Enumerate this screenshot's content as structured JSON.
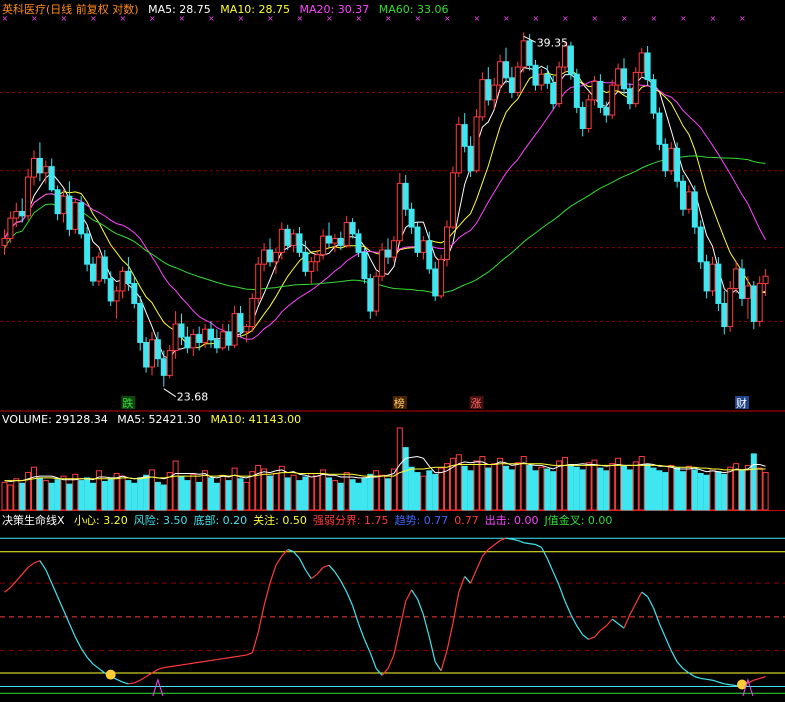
{
  "colors": {
    "background": "#000000",
    "up": "#ff3b3b",
    "down": "#3fe6f0",
    "ma5": "#ffffff",
    "ma10": "#ffff33",
    "ma20": "#ff44ff",
    "ma60": "#33dd33",
    "grid": "#8b0000",
    "separator": "#c00000",
    "marker": "#ff44ff"
  },
  "price_panel": {
    "title": "英科医疗(日线 前复权 对数)",
    "ma5": "MA5: 28.75",
    "ma10": "MA10: 28.75",
    "ma20": "MA20: 30.37",
    "ma60": "MA60: 33.06",
    "high_label": "39.35",
    "low_label": "23.68",
    "events": [
      {
        "text": "跌",
        "color": "#33dd33",
        "bg": "#114411",
        "index": 21
      },
      {
        "text": "榜",
        "color": "#ffcc66",
        "bg": "#442200",
        "index": 67
      },
      {
        "text": "涨",
        "color": "#ff6666",
        "bg": "#441111",
        "index": 80
      },
      {
        "text": "财",
        "color": "#ffffff",
        "bg": "#224488",
        "index": 125
      }
    ]
  },
  "volume_panel": {
    "volume": "VOLUME: 29128.34",
    "ma5": "MA5: 52421.30",
    "ma10": "MA10: 41143.00"
  },
  "indicator_panel": {
    "name": "决策生命线X",
    "items": [
      {
        "text": "小心: 3.20",
        "color": "#ffff33"
      },
      {
        "text": "风险: 3.50",
        "color": "#3fe6f0"
      },
      {
        "text": "底部: 0.20",
        "color": "#3fe6f0"
      },
      {
        "text": "关注: 0.50",
        "color": "#ffff33"
      },
      {
        "text": "强弱分界: 1.75",
        "color": "#ff3b3b"
      },
      {
        "text": "趋势: 0.77",
        "color": "#4466ff"
      },
      {
        "text": "0.77",
        "color": "#ff3b3b"
      },
      {
        "text": "出击: 0.00",
        "color": "#ff44ff"
      },
      {
        "text": "J值金叉: 0.00",
        "color": "#33dd33"
      }
    ],
    "levels": [
      3.5,
      3.2,
      1.75,
      0.5,
      0.2
    ]
  },
  "chart_data": {
    "type": "candlestick",
    "yscale": "log",
    "ylim": [
      22.8,
      41.0
    ],
    "ohlc": [
      [
        29.1,
        29.8,
        28.7,
        29.4
      ],
      [
        29.4,
        30.6,
        29.2,
        30.3
      ],
      [
        30.3,
        31.0,
        29.9,
        30.6
      ],
      [
        30.6,
        31.2,
        30.1,
        30.4
      ],
      [
        30.4,
        32.6,
        30.2,
        32.2
      ],
      [
        32.2,
        33.5,
        31.8,
        33.1
      ],
      [
        33.1,
        33.9,
        32.0,
        32.4
      ],
      [
        32.4,
        33.0,
        31.9,
        32.7
      ],
      [
        32.7,
        33.1,
        31.5,
        31.6
      ],
      [
        31.6,
        31.8,
        30.2,
        30.5
      ],
      [
        30.5,
        31.6,
        30.1,
        31.3
      ],
      [
        31.3,
        32.0,
        29.5,
        29.8
      ],
      [
        29.8,
        31.2,
        29.6,
        31.0
      ],
      [
        31.0,
        31.3,
        29.4,
        29.6
      ],
      [
        29.6,
        29.9,
        28.0,
        28.3
      ],
      [
        28.3,
        28.6,
        27.4,
        27.6
      ],
      [
        27.6,
        28.8,
        27.4,
        28.6
      ],
      [
        28.6,
        28.9,
        27.5,
        27.7
      ],
      [
        27.7,
        28.0,
        26.6,
        26.8
      ],
      [
        26.8,
        27.4,
        26.1,
        27.2
      ],
      [
        27.2,
        28.2,
        26.9,
        28.0
      ],
      [
        28.0,
        28.6,
        27.2,
        27.5
      ],
      [
        27.5,
        27.8,
        26.5,
        26.7
      ],
      [
        26.7,
        27.0,
        24.9,
        25.2
      ],
      [
        25.2,
        25.4,
        24.1,
        24.3
      ],
      [
        24.3,
        25.6,
        24.0,
        25.3
      ],
      [
        25.3,
        25.6,
        24.3,
        24.6
      ],
      [
        24.6,
        24.9,
        23.6,
        24.0
      ],
      [
        24.0,
        25.1,
        23.9,
        24.9
      ],
      [
        24.9,
        26.4,
        24.6,
        25.9
      ],
      [
        25.9,
        26.3,
        25.1,
        25.4
      ],
      [
        25.4,
        25.8,
        24.8,
        25.0
      ],
      [
        25.0,
        25.7,
        24.7,
        25.5
      ],
      [
        25.5,
        25.8,
        24.9,
        25.2
      ],
      [
        25.2,
        25.9,
        25.0,
        25.7
      ],
      [
        25.7,
        26.0,
        25.0,
        25.3
      ],
      [
        25.3,
        25.7,
        24.8,
        25.0
      ],
      [
        25.0,
        25.9,
        24.9,
        25.6
      ],
      [
        25.6,
        25.9,
        24.9,
        25.1
      ],
      [
        25.1,
        26.6,
        25.0,
        26.3
      ],
      [
        26.3,
        26.6,
        25.4,
        25.6
      ],
      [
        25.6,
        25.9,
        25.2,
        25.8
      ],
      [
        25.8,
        27.1,
        25.6,
        26.9
      ],
      [
        26.9,
        28.6,
        26.7,
        28.3
      ],
      [
        28.3,
        29.2,
        28.0,
        28.9
      ],
      [
        28.9,
        29.4,
        28.2,
        28.4
      ],
      [
        28.4,
        29.0,
        27.9,
        28.8
      ],
      [
        28.8,
        30.1,
        28.5,
        29.8
      ],
      [
        29.8,
        30.0,
        28.9,
        29.1
      ],
      [
        29.1,
        29.8,
        28.8,
        29.6
      ],
      [
        29.6,
        29.9,
        28.6,
        28.8
      ],
      [
        28.8,
        29.3,
        27.8,
        28.0
      ],
      [
        28.0,
        28.6,
        27.5,
        28.4
      ],
      [
        28.4,
        28.9,
        28.0,
        28.7
      ],
      [
        28.7,
        29.8,
        28.5,
        29.5
      ],
      [
        29.5,
        30.1,
        29.0,
        29.2
      ],
      [
        29.2,
        29.6,
        28.8,
        29.4
      ],
      [
        29.4,
        29.7,
        28.9,
        29.1
      ],
      [
        29.1,
        30.4,
        29.0,
        30.1
      ],
      [
        30.1,
        30.3,
        29.4,
        29.6
      ],
      [
        29.6,
        29.8,
        28.6,
        28.8
      ],
      [
        28.8,
        29.0,
        27.5,
        27.7
      ],
      [
        27.7,
        27.9,
        26.1,
        26.4
      ],
      [
        26.4,
        28.0,
        26.2,
        27.8
      ],
      [
        27.8,
        29.2,
        27.6,
        28.9
      ],
      [
        28.9,
        29.4,
        28.3,
        28.6
      ],
      [
        28.6,
        29.5,
        28.4,
        29.3
      ],
      [
        29.3,
        32.4,
        29.2,
        31.9
      ],
      [
        31.9,
        32.3,
        30.4,
        30.7
      ],
      [
        30.7,
        31.0,
        29.6,
        29.9
      ],
      [
        29.9,
        30.1,
        28.6,
        28.8
      ],
      [
        28.8,
        29.5,
        28.5,
        29.3
      ],
      [
        29.3,
        29.7,
        27.9,
        28.1
      ],
      [
        28.1,
        28.4,
        26.8,
        27.0
      ],
      [
        27.0,
        28.7,
        26.9,
        28.5
      ],
      [
        28.5,
        30.2,
        28.2,
        29.9
      ],
      [
        29.9,
        32.7,
        29.8,
        32.4
      ],
      [
        32.4,
        35.2,
        32.2,
        34.8
      ],
      [
        34.8,
        35.4,
        33.4,
        33.7
      ],
      [
        33.7,
        34.2,
        32.2,
        32.5
      ],
      [
        32.5,
        35.6,
        32.4,
        35.2
      ],
      [
        35.2,
        37.6,
        35.0,
        37.2
      ],
      [
        37.2,
        37.9,
        35.8,
        36.1
      ],
      [
        36.1,
        37.3,
        35.6,
        36.9
      ],
      [
        36.9,
        38.6,
        36.6,
        38.2
      ],
      [
        38.2,
        39.0,
        37.0,
        37.3
      ],
      [
        37.3,
        37.9,
        36.2,
        36.5
      ],
      [
        36.5,
        38.2,
        36.3,
        37.9
      ],
      [
        37.9,
        39.9,
        37.6,
        39.4
      ],
      [
        39.4,
        39.8,
        37.7,
        38.0
      ],
      [
        38.0,
        38.3,
        36.6,
        36.9
      ],
      [
        36.9,
        37.8,
        36.6,
        37.5
      ],
      [
        37.5,
        38.0,
        36.7,
        37.0
      ],
      [
        37.0,
        37.4,
        35.6,
        35.9
      ],
      [
        35.9,
        38.2,
        35.7,
        37.9
      ],
      [
        37.9,
        39.4,
        37.6,
        39.1
      ],
      [
        39.1,
        39.35,
        37.2,
        37.5
      ],
      [
        37.5,
        37.8,
        35.4,
        35.7
      ],
      [
        35.7,
        36.0,
        34.2,
        34.6
      ],
      [
        34.6,
        36.4,
        34.4,
        36.1
      ],
      [
        36.1,
        37.4,
        35.8,
        37.1
      ],
      [
        37.1,
        37.5,
        35.4,
        35.7
      ],
      [
        35.7,
        36.0,
        34.9,
        35.3
      ],
      [
        35.3,
        37.2,
        35.1,
        36.9
      ],
      [
        36.9,
        38.1,
        36.6,
        37.8
      ],
      [
        37.8,
        38.4,
        36.4,
        36.7
      ],
      [
        36.7,
        37.0,
        35.6,
        35.9
      ],
      [
        35.9,
        37.9,
        35.7,
        37.6
      ],
      [
        37.6,
        39.0,
        37.3,
        38.7
      ],
      [
        38.7,
        39.1,
        36.9,
        37.2
      ],
      [
        37.2,
        37.5,
        35.1,
        35.4
      ],
      [
        35.4,
        35.7,
        33.5,
        33.8
      ],
      [
        33.8,
        34.1,
        32.2,
        32.5
      ],
      [
        32.5,
        33.9,
        32.3,
        33.6
      ],
      [
        33.6,
        33.9,
        31.7,
        32.0
      ],
      [
        32.0,
        32.3,
        30.4,
        30.7
      ],
      [
        30.7,
        31.8,
        30.5,
        31.5
      ],
      [
        31.5,
        31.8,
        29.6,
        29.9
      ],
      [
        29.9,
        30.2,
        28.1,
        28.4
      ],
      [
        28.4,
        28.7,
        26.9,
        27.2
      ],
      [
        27.2,
        28.6,
        27.0,
        28.3
      ],
      [
        28.3,
        28.6,
        26.4,
        26.7
      ],
      [
        26.7,
        27.2,
        25.5,
        25.8
      ],
      [
        25.8,
        27.6,
        25.6,
        27.3
      ],
      [
        27.3,
        28.4,
        27.1,
        28.1
      ],
      [
        28.1,
        28.5,
        26.6,
        26.9
      ],
      [
        26.9,
        27.8,
        26.1,
        27.4
      ],
      [
        27.4,
        27.6,
        25.7,
        26.0
      ],
      [
        26.0,
        27.8,
        25.8,
        27.5
      ],
      [
        27.5,
        28.1,
        27.0,
        27.8
      ]
    ],
    "ma_series": [
      {
        "name": "MA5",
        "color": "#ffffff",
        "period": 5
      },
      {
        "name": "MA10",
        "color": "#ffff33",
        "period": 10
      },
      {
        "name": "MA20",
        "color": "#ff44ff",
        "period": 20
      },
      {
        "name": "MA60",
        "color": "#33dd33",
        "period": 60
      }
    ],
    "volume": [
      31,
      28,
      35,
      30,
      42,
      48,
      36,
      33,
      30,
      34,
      38,
      29,
      40,
      33,
      36,
      30,
      44,
      32,
      35,
      41,
      38,
      33,
      30,
      36,
      39,
      45,
      31,
      28,
      42,
      55,
      37,
      33,
      40,
      31,
      44,
      36,
      30,
      38,
      33,
      47,
      35,
      31,
      43,
      50,
      46,
      38,
      41,
      49,
      36,
      39,
      33,
      37,
      41,
      38,
      45,
      36,
      33,
      30,
      42,
      34,
      30,
      36,
      40,
      44,
      39,
      35,
      46,
      92,
      70,
      48,
      42,
      38,
      44,
      40,
      47,
      52,
      58,
      62,
      49,
      44,
      55,
      60,
      47,
      52,
      58,
      49,
      45,
      53,
      60,
      50,
      44,
      48,
      46,
      43,
      55,
      59,
      51,
      48,
      45,
      53,
      56,
      47,
      44,
      52,
      58,
      49,
      45,
      54,
      60,
      51,
      47,
      44,
      42,
      50,
      47,
      43,
      49,
      45,
      41,
      39,
      46,
      43,
      40,
      48,
      52,
      44,
      50,
      63,
      47,
      42
    ],
    "volume_ma5": [
      33,
      32,
      33,
      33,
      35,
      37,
      38,
      38,
      38,
      36,
      34,
      34,
      34,
      35,
      35,
      34,
      37,
      37,
      36,
      36,
      38,
      36,
      35,
      36,
      37,
      37,
      36,
      35,
      37,
      41,
      41,
      41,
      41,
      40,
      41,
      37,
      36,
      38,
      37,
      39,
      37,
      36,
      38,
      41,
      43,
      42,
      44,
      45,
      42,
      43,
      40,
      39,
      37,
      38,
      40,
      39,
      39,
      37,
      37,
      37,
      36,
      36,
      37,
      37,
      38,
      39,
      41,
      51,
      58,
      59,
      60,
      58,
      49,
      42,
      42,
      44,
      48,
      52,
      54,
      53,
      54,
      54,
      51,
      51,
      54,
      53,
      50,
      51,
      53,
      51,
      50,
      50,
      48,
      46,
      49,
      50,
      51,
      51,
      52,
      51,
      51,
      50,
      49,
      50,
      51,
      50,
      50,
      50,
      51,
      52,
      51,
      49,
      49,
      48,
      46,
      46,
      46,
      47,
      45,
      43,
      44,
      43,
      42,
      43,
      46,
      45,
      46,
      51,
      51,
      49
    ],
    "volume_ma10": [
      33,
      33,
      33,
      33,
      34,
      35,
      36,
      36,
      36,
      35,
      35,
      35,
      35,
      35,
      35,
      35,
      35,
      35,
      35,
      35,
      36,
      36,
      35,
      35,
      36,
      37,
      36,
      36,
      37,
      38,
      38,
      38,
      38,
      38,
      39,
      38,
      38,
      39,
      38,
      39,
      38,
      38,
      38,
      39,
      40,
      40,
      41,
      42,
      42,
      42,
      41,
      41,
      41,
      41,
      41,
      40,
      40,
      40,
      40,
      40,
      39,
      38,
      38,
      38,
      38,
      38,
      38,
      42,
      44,
      46,
      46,
      46,
      47,
      48,
      48,
      48,
      50,
      51,
      51,
      51,
      51,
      51,
      51,
      51,
      52,
      52,
      52,
      52,
      52,
      52,
      52,
      52,
      51,
      50,
      50,
      50,
      50,
      50,
      50,
      50,
      50,
      50,
      50,
      50,
      50,
      50,
      50,
      50,
      50,
      50,
      50,
      50,
      49,
      49,
      48,
      48,
      48,
      48,
      47,
      47,
      46,
      46,
      45,
      45,
      45,
      45,
      45,
      46,
      46,
      46
    ],
    "indicator": [
      2.3,
      2.4,
      2.55,
      2.7,
      2.85,
      2.95,
      3.0,
      2.8,
      2.5,
      2.2,
      1.9,
      1.6,
      1.3,
      1.05,
      0.85,
      0.7,
      0.6,
      0.5,
      0.42,
      0.36,
      0.3,
      0.26,
      0.28,
      0.34,
      0.42,
      0.5,
      0.58,
      0.62,
      0.64,
      0.66,
      0.68,
      0.7,
      0.72,
      0.74,
      0.76,
      0.78,
      0.8,
      0.82,
      0.84,
      0.86,
      0.88,
      0.9,
      0.95,
      1.4,
      2.0,
      2.5,
      2.9,
      3.1,
      3.25,
      3.2,
      3.05,
      2.8,
      2.6,
      2.7,
      2.85,
      2.9,
      2.75,
      2.55,
      2.3,
      2.0,
      1.6,
      1.25,
      0.95,
      0.6,
      0.45,
      0.6,
      0.9,
      1.5,
      2.1,
      2.35,
      2.15,
      1.8,
      1.3,
      0.75,
      0.55,
      1.0,
      1.6,
      2.3,
      2.65,
      2.5,
      2.8,
      3.1,
      3.25,
      3.35,
      3.45,
      3.5,
      3.48,
      3.45,
      3.4,
      3.38,
      3.36,
      3.3,
      3.05,
      2.75,
      2.45,
      2.1,
      1.8,
      1.55,
      1.35,
      1.25,
      1.3,
      1.45,
      1.55,
      1.7,
      1.6,
      1.5,
      1.8,
      2.05,
      2.3,
      2.2,
      1.95,
      1.6,
      1.3,
      1.0,
      0.75,
      0.6,
      0.5,
      0.42,
      0.38,
      0.36,
      0.34,
      0.3,
      0.26,
      0.24,
      0.22,
      0.2,
      0.28,
      0.34,
      0.38,
      0.42
    ],
    "indicator_ylim": [
      -0.1,
      3.75
    ]
  }
}
